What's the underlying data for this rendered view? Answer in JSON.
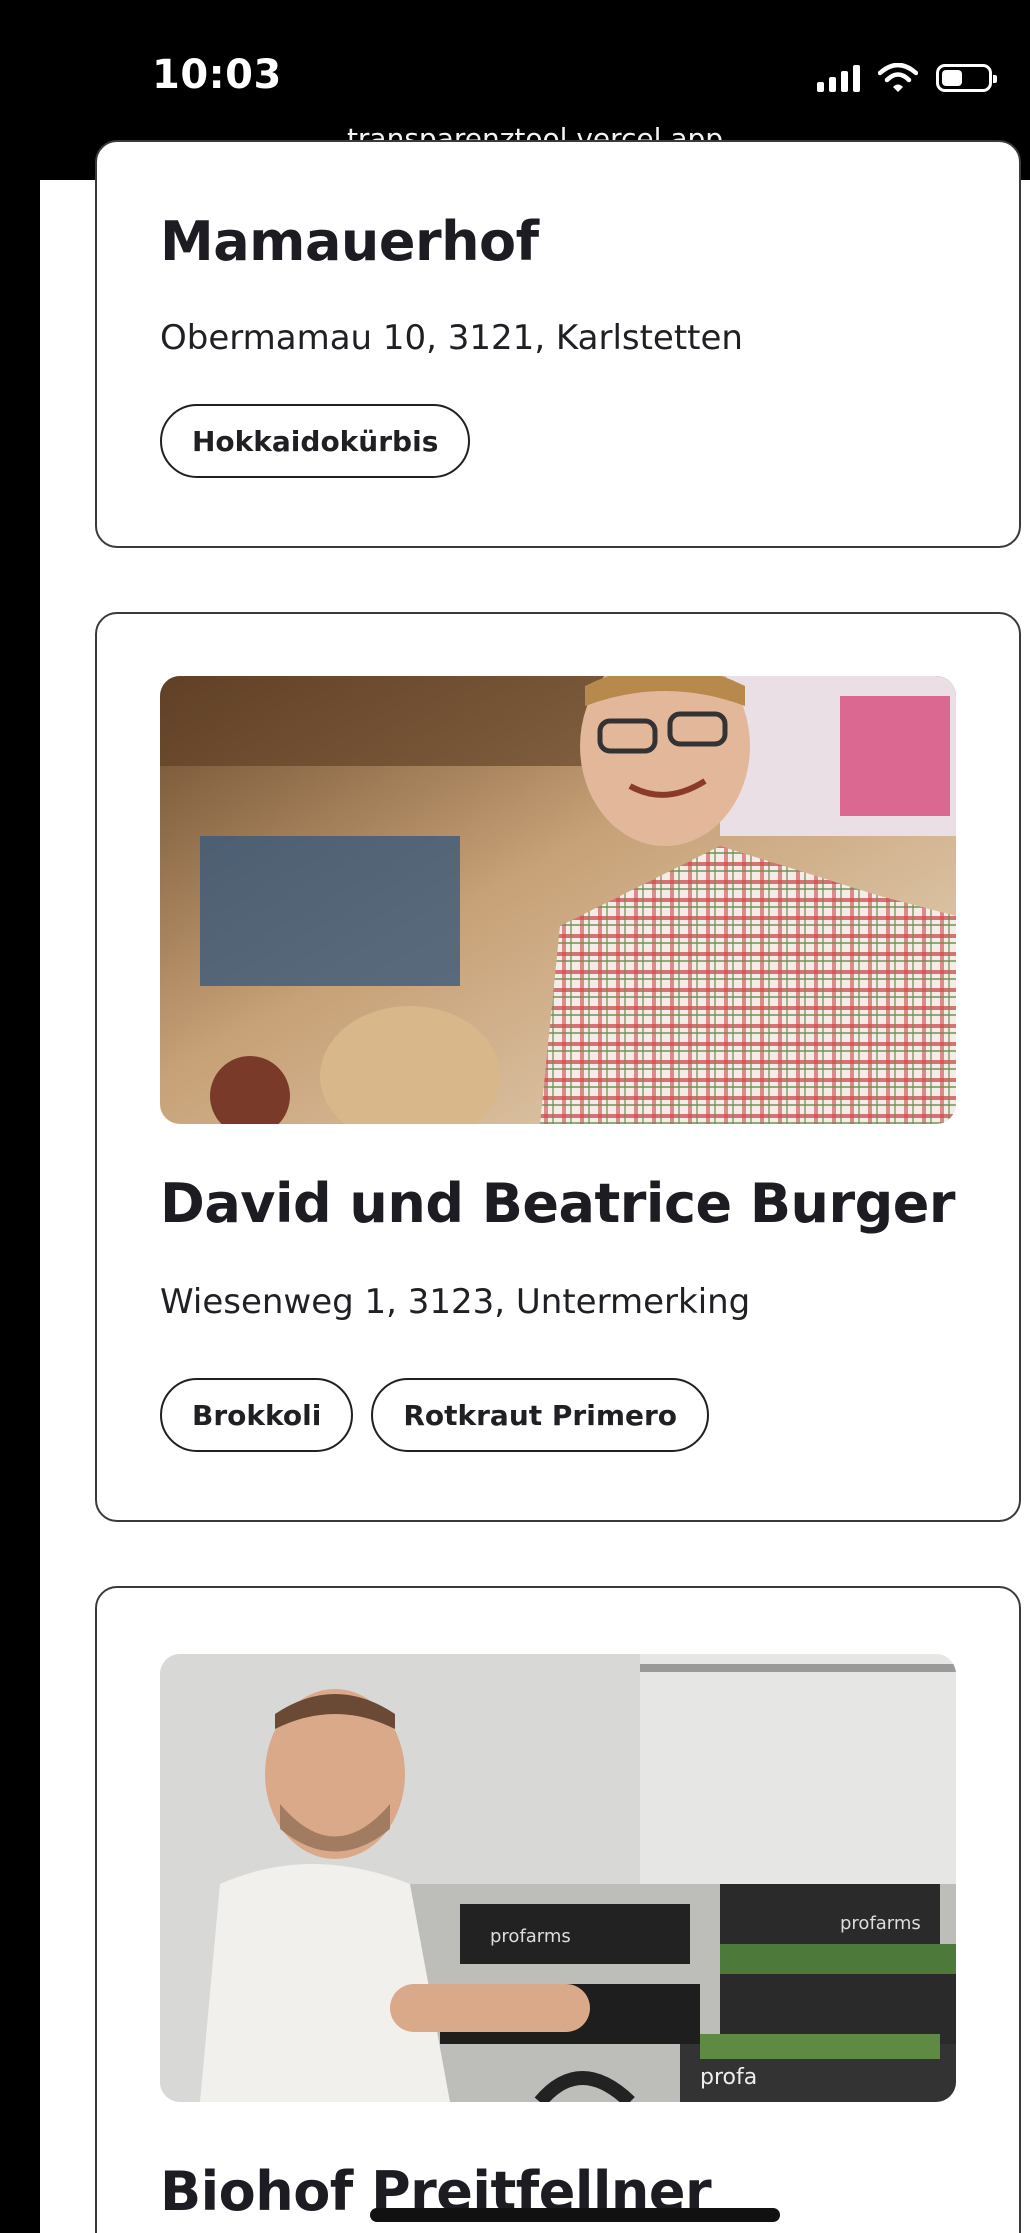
{
  "status_bar": {
    "time": "10:03",
    "url": "transparenztool.vercel.app",
    "icons": [
      "signal-icon",
      "wifi-icon",
      "battery-icon"
    ]
  },
  "farms": [
    {
      "name": "Mamauerhof",
      "address": "Obermamau 10, 3121, Karlstetten",
      "products": [
        "Hokkaidokürbis"
      ]
    },
    {
      "name": "David und Beatrice Burger",
      "address": "Wiesenweg 1, 3123, Untermerking",
      "products": [
        "Brokkoli",
        "Rotkraut Primero"
      ]
    },
    {
      "name": "Biohof Preitfellner",
      "photo_text": [
        "profarms",
        "profarms",
        "profarms",
        "profa"
      ]
    }
  ],
  "colors": {
    "text": "#1c1c22",
    "card_border": "#3a3a3a",
    "status_bar_bg": "#000000"
  }
}
